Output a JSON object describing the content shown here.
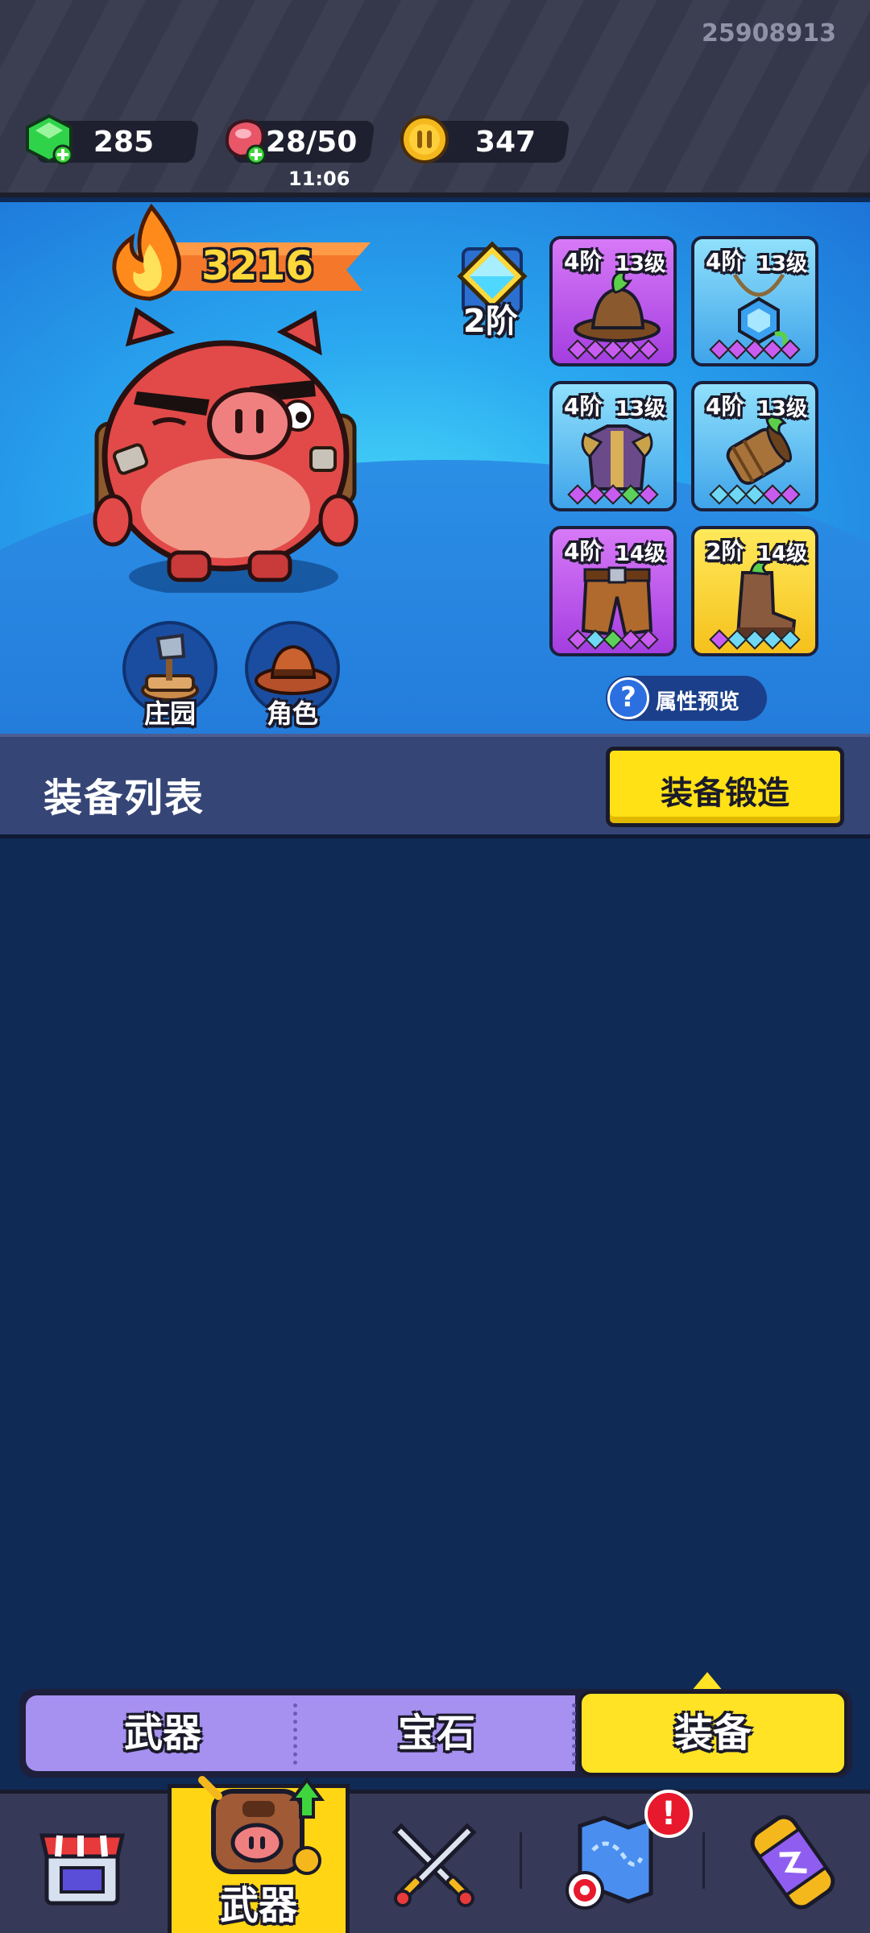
{
  "player_id": "25908913",
  "resources": {
    "gems": "285",
    "energy": "28/50",
    "energy_timer": "11:06",
    "coins": "347"
  },
  "hero": {
    "power": "3216",
    "tier_label": "2阶",
    "buttons": [
      {
        "label": "庄园",
        "icon": "farm-axe-icon"
      },
      {
        "label": "角色",
        "icon": "cowboy-hat-icon"
      }
    ]
  },
  "equipment_slots": [
    {
      "stage": "4阶",
      "level": "13级",
      "rarity": "purple",
      "icon": "hat-icon",
      "gems": [
        "#c85cf0",
        "#c85cf0",
        "#c85cf0",
        "#c85cf0",
        "#c85cf0"
      ]
    },
    {
      "stage": "4阶",
      "level": "13级",
      "rarity": "blue",
      "icon": "amulet-icon",
      "gems": [
        "#c85cf0",
        "#c85cf0",
        "#c85cf0",
        "#c85cf0",
        "#c85cf0"
      ]
    },
    {
      "stage": "4阶",
      "level": "13级",
      "rarity": "blue",
      "icon": "armor-icon",
      "gems": [
        "#c85cf0",
        "#c85cf0",
        "#c85cf0",
        "#5bd05b",
        "#c85cf0"
      ]
    },
    {
      "stage": "4阶",
      "level": "13级",
      "rarity": "blue",
      "icon": "bracer-icon",
      "gems": [
        "#6fd8f5",
        "#6fd8f5",
        "#6fd8f5",
        "#c85cf0",
        "#c85cf0"
      ]
    },
    {
      "stage": "4阶",
      "level": "14级",
      "rarity": "purple",
      "icon": "pants-icon",
      "gems": [
        "#c85cf0",
        "#6fd8f5",
        "#5bd05b",
        "#c85cf0",
        "#c85cf0"
      ]
    },
    {
      "stage": "2阶",
      "level": "14级",
      "rarity": "gold",
      "icon": "boots-icon",
      "gems": [
        "#c85cf0",
        "#6fd8f5",
        "#6fd8f5",
        "#6fd8f5",
        "#6fd8f5"
      ]
    }
  ],
  "attr_preview_label": "属性预览",
  "list": {
    "title": "装备列表",
    "forge_label": "装备锻造"
  },
  "subtabs": [
    {
      "label": "武器",
      "active": false
    },
    {
      "label": "宝石",
      "active": false
    },
    {
      "label": "装备",
      "active": true
    }
  ],
  "bottom_nav": {
    "items": [
      {
        "name": "shop",
        "icon": "shop-icon"
      },
      {
        "name": "weapons",
        "icon": "backpack-icon",
        "label": "武器",
        "active": true
      },
      {
        "name": "battle",
        "icon": "crossed-swords-icon"
      },
      {
        "name": "map",
        "icon": "map-target-icon",
        "alert": "!"
      },
      {
        "name": "summon",
        "icon": "capsule-icon"
      }
    ]
  },
  "colors": {
    "accent_yellow": "#ffe116",
    "panel_blue": "#2aa8f0",
    "background_navy": "#0f2a55"
  }
}
